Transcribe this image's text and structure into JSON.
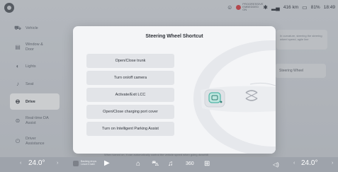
{
  "status": {
    "recording_line1": "PROGRESSIVE",
    "recording_line2": "EMBEDDED ON",
    "range": "416 km",
    "battery": "81%",
    "time": "18:49"
  },
  "sidebar": {
    "items": [
      {
        "label": "Vehicle",
        "icon": "car-icon"
      },
      {
        "label": "Window & Door",
        "icon": "window-icon"
      },
      {
        "label": "Lights",
        "icon": "light-icon"
      },
      {
        "label": "Seat",
        "icon": "seat-icon"
      },
      {
        "label": "Drive",
        "icon": "steering-icon"
      },
      {
        "label": "Real-time DA Assist",
        "icon": "assist-icon"
      },
      {
        "label": "Driver Assistance",
        "icon": "driver-assist-icon"
      }
    ]
  },
  "background": {
    "right_panel_text": "In curvature, steering the steering wheel speed, agile line",
    "right_pill_text": "Steering Wheel",
    "bottom_note": "When turned on, it can automatically control the vehicle speed when going downhill"
  },
  "modal": {
    "title": "Steering Wheel Shortcut",
    "options": [
      "Open/Close trunk",
      "Turn on/off camera",
      "Activate/Exit LCC",
      "Open/Close charging port cover",
      "Turn on Intelligent Parking Assist"
    ]
  },
  "dock": {
    "temp_left": "24.0°",
    "temp_right": "24.0°",
    "media_line1": "Backing drops",
    "media_line2": "Leave it later"
  }
}
